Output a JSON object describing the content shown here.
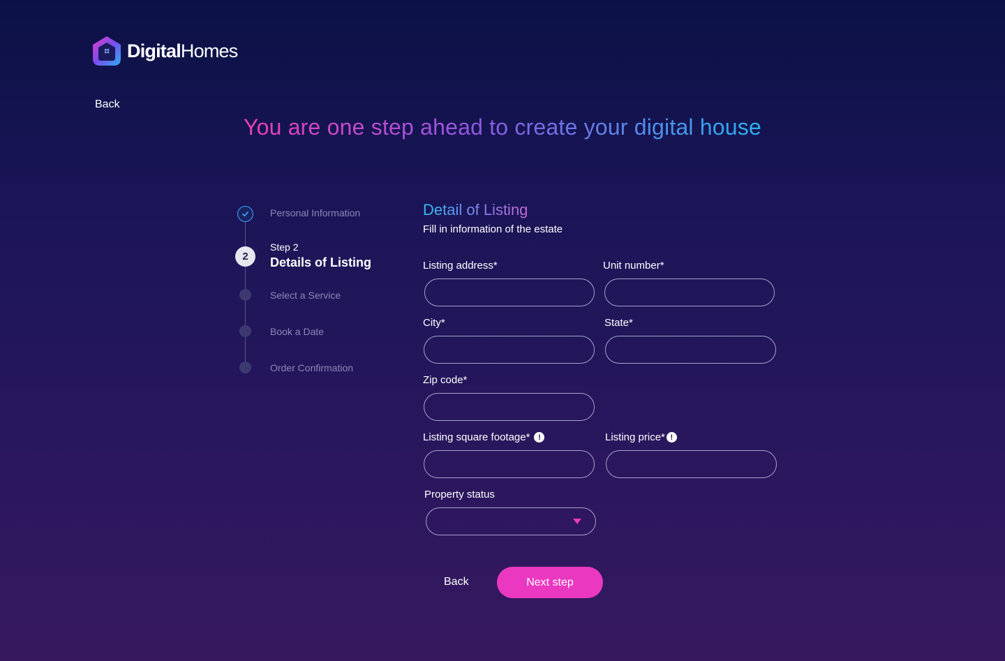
{
  "brand": {
    "name_bold": "Digital",
    "name_light": "Homes",
    "accent_pink": "#ea38c0",
    "accent_blue": "#2ab1f0"
  },
  "nav": {
    "back_label": "Back"
  },
  "headline": "You are one step ahead to create your digital house",
  "stepper": {
    "steps": [
      {
        "label": "Personal Information",
        "status": "completed"
      },
      {
        "sub": "Step 2",
        "number": "2",
        "label": "Details of Listing",
        "status": "current"
      },
      {
        "label": "Select a Service",
        "status": "upcoming"
      },
      {
        "label": "Book a Date",
        "status": "upcoming"
      },
      {
        "label": "Order Confirmation",
        "status": "upcoming"
      }
    ]
  },
  "form": {
    "title": "Detail of Listing",
    "subtitle": "Fill in information of the estate",
    "fields": {
      "listing_address": {
        "label": "Listing address*",
        "value": ""
      },
      "unit_number": {
        "label": "Unit number*",
        "value": ""
      },
      "city": {
        "label": "City*",
        "value": ""
      },
      "state": {
        "label": "State*",
        "value": ""
      },
      "zip_code": {
        "label": "Zip code*",
        "value": ""
      },
      "square_footage": {
        "label": "Listing square footage*",
        "value": "",
        "info_icon": "!"
      },
      "listing_price": {
        "label": "Listing price*",
        "value": "",
        "info_icon": "!"
      },
      "property_status": {
        "label": "Property status",
        "value": ""
      }
    },
    "back_label": "Back",
    "next_label": "Next step"
  }
}
